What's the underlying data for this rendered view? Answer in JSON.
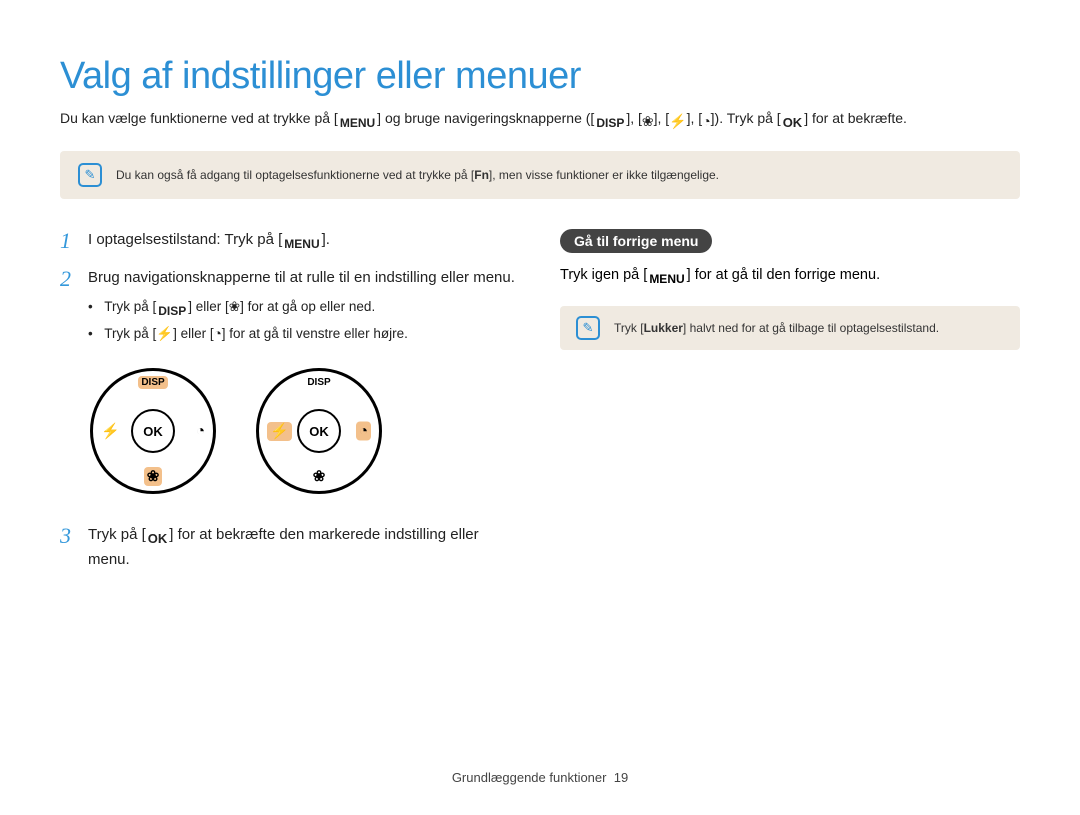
{
  "title": "Valg af indstillinger eller menuer",
  "intro": {
    "p1": "Du kan vælge funktionerne ved at trykke på [",
    "p2": "] og bruge navigeringsknapperne ([",
    "p3": "], [",
    "p4": "], [",
    "p5": "], [",
    "p6": "]). Tryk på [",
    "p7": "] for at bekræfte."
  },
  "keys": {
    "menu": "MENU",
    "disp": "DISP",
    "ok": "OK",
    "fn": "Fn",
    "lukker": "Lukker"
  },
  "note1": {
    "a": "Du kan også få adgang til optagelsesfunktionerne ved at trykke på [",
    "b": "], men visse funktioner er ikke tilgængelige."
  },
  "steps": {
    "s1": {
      "num": "1",
      "a": "I optagelsestilstand: Tryk på [",
      "b": "]."
    },
    "s2": {
      "num": "2",
      "text": "Brug navigationsknapperne til at rulle til en indstilling eller menu.",
      "sub1": {
        "a": "Tryk på [",
        "b": "] eller [",
        "c": "] for at gå op eller ned."
      },
      "sub2": {
        "a": "Tryk på [",
        "b": "] eller [",
        "c": "] for at gå til venstre eller højre."
      }
    },
    "s3": {
      "num": "3",
      "a": "Tryk på [",
      "b": "] for at bekræfte den markerede indstilling eller menu."
    }
  },
  "dial": {
    "top": "DISP",
    "center": "OK",
    "left_glyph": "⚡",
    "right_glyph": "◔",
    "bottom_glyph": "❀"
  },
  "right": {
    "pill": "Gå til forrige menu",
    "text_a": "Tryk igen på [",
    "text_b": "] for at gå til den forrige menu.",
    "note_a": "Tryk [",
    "note_b": "] halvt ned for at gå tilbage til optagelsestilstand."
  },
  "footer": {
    "label": "Grundlæggende funktioner",
    "page": "19"
  }
}
